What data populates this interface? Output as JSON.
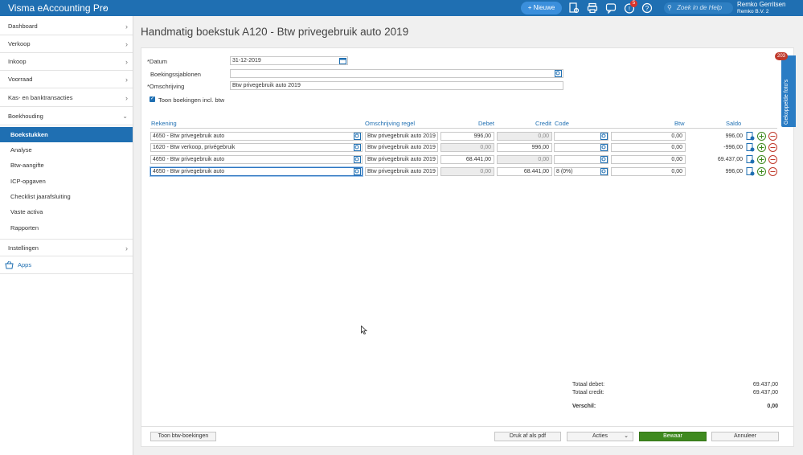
{
  "topbar": {
    "app_title": "Visma eAccounting Pro",
    "new_button_label": "Nieuwe",
    "notification_count": "5",
    "help_search_placeholder": "Zoek in de Help",
    "user_name": "Remko Gerritsen",
    "company_name": "Remko B.V. 2",
    "bar_color": "#1f6fb2"
  },
  "sidebar": {
    "items": [
      {
        "label": "Dashboard"
      },
      {
        "label": "Verkoop"
      },
      {
        "label": "Inkoop"
      },
      {
        "label": "Voorraad"
      },
      {
        "label": "Kas- en banktransacties"
      },
      {
        "label": "Boekhouding"
      }
    ],
    "sub_items": [
      {
        "label": "Boekstukken"
      },
      {
        "label": "Analyse"
      },
      {
        "label": "Btw-aangifte"
      },
      {
        "label": "ICP-opgaven"
      },
      {
        "label": "Checklist jaarafsluiting"
      },
      {
        "label": "Vaste activa"
      },
      {
        "label": "Rapporten"
      }
    ],
    "settings_label": "Instellingen",
    "apps_label": "Apps",
    "active_color": "#1f6fb2"
  },
  "page": {
    "title": "Handmatig boekstuk A120  -  Btw privegebruik auto 2019"
  },
  "form": {
    "date_label": "*Datum",
    "date_value": "31-12-2019",
    "template_label": "Boekingssjablonen",
    "template_value": "",
    "description_label": "*Omschrijving",
    "description_value": "Btw privegebruik auto 2019",
    "show_incl_vat_label": "Toon boekingen incl. btw"
  },
  "table": {
    "headers": {
      "account": "Rekening",
      "line_description": "Omschrijving regel",
      "debit": "Debet",
      "credit": "Credit",
      "code": "Code",
      "vat": "Btw",
      "balance": "Saldo"
    },
    "rows": [
      {
        "account": "4650 - Btw privegebruik auto",
        "description": "Btw privegebruik auto 2019",
        "debit": "996,00",
        "credit": "0,00",
        "code": "",
        "vat": "0,00",
        "balance": "996,00"
      },
      {
        "account": "1620 - Btw verkoop, privégebruik",
        "description": "Btw privegebruik auto 2019",
        "debit": "0,00",
        "credit": "996,00",
        "code": "",
        "vat": "0,00",
        "balance": "-996,00"
      },
      {
        "account": "4650 - Btw privegebruik auto",
        "description": "Btw privegebruik auto 2019",
        "debit": "68.441,00",
        "credit": "0,00",
        "code": "",
        "vat": "0,00",
        "balance": "69.437,00"
      },
      {
        "account": "4650 - Btw privegebruik auto",
        "description": "Btw privegebruik auto 2019",
        "debit": "0,00",
        "credit": "68.441,00",
        "code": "8 (0%)",
        "vat": "0,00",
        "balance": "996,00"
      }
    ]
  },
  "totals": {
    "debit_label": "Totaal debet:",
    "debit_value": "69.437,00",
    "credit_label": "Totaal credit:",
    "credit_value": "69.437,00",
    "difference_label": "Verschil:",
    "difference_value": "0,00"
  },
  "footer": {
    "show_vat_button": "Toon btw-boekingen",
    "print_pdf_button": "Druk af als pdf",
    "actions_button": "Acties",
    "save_button": "Bewaar",
    "cancel_button": "Annuleer",
    "save_color": "#3f8a1f"
  },
  "side_tab": {
    "label": "Gekoppelde foto's",
    "badge": "203"
  }
}
